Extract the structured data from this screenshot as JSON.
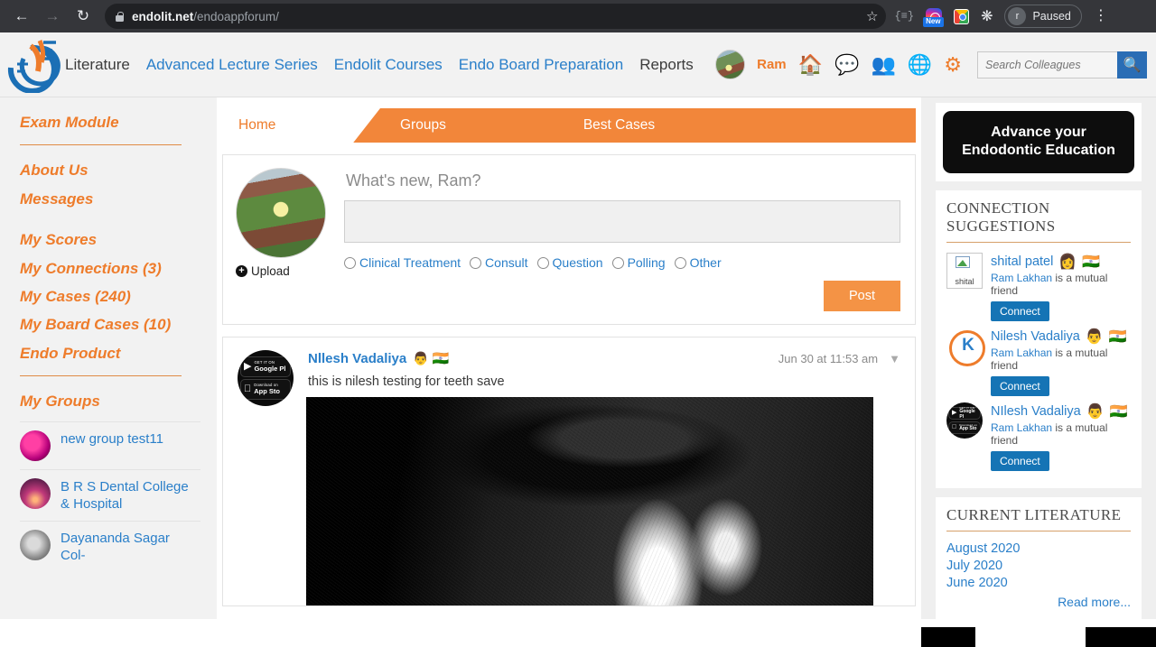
{
  "browser": {
    "back_icon": "back-arrow",
    "forward_icon": "forward-arrow",
    "reload_icon": "reload",
    "url_domain": "endolit.net",
    "url_path": "/endoappforum/",
    "bookmark_icon": "star",
    "ext_brackets_label": "{≡}",
    "new_badge": "New",
    "profile_initial": "r",
    "profile_status": "Paused",
    "menu_icon": "kebab-menu"
  },
  "header": {
    "logo_alt": "Endolit logo",
    "nav": [
      {
        "label": "Literature",
        "style": "dark"
      },
      {
        "label": "Advanced Lecture Series",
        "style": "link"
      },
      {
        "label": "Endolit Courses",
        "style": "link"
      },
      {
        "label": "Endo Board Preparation",
        "style": "link"
      },
      {
        "label": "Reports",
        "style": "dark"
      }
    ],
    "user_name": "Ram",
    "icons": [
      "home-icon",
      "chat-icon",
      "friends-icon",
      "globe-icon",
      "gear-icon"
    ],
    "search_placeholder": "Search Colleagues",
    "search_value": ""
  },
  "sidebar": {
    "links_top": [
      "Exam Module"
    ],
    "links_mid": [
      "About Us",
      "Messages"
    ],
    "links_counts": [
      "My Scores",
      "My Connections (3)",
      "My Cases (240)",
      "My Board Cases (10)",
      "Endo Product"
    ],
    "groups_title": "My Groups",
    "groups": [
      {
        "name": "new group test11"
      },
      {
        "name": "B R S Dental College & Hospital"
      },
      {
        "name": "Dayananda Sagar Col-"
      }
    ]
  },
  "tabs": [
    {
      "label": "Home",
      "active": true
    },
    {
      "label": "Groups",
      "active": false
    },
    {
      "label": "Best Cases",
      "active": false
    }
  ],
  "composer": {
    "prompt": "What's new, Ram?",
    "textarea_value": "",
    "upload_label": "Upload",
    "options": [
      "Clinical Treatment",
      "Consult",
      "Question",
      "Polling",
      "Other"
    ],
    "post_label": "Post"
  },
  "feed": [
    {
      "author": "Nllesh Vadaliya",
      "time": "Jun 30 at 11:53 am",
      "text": "this is nilesh testing for teeth save",
      "image_alt": "dental x-ray radiograph",
      "avatar_badges": [
        "GET IT ON Google Play",
        "Download on the App Store"
      ]
    }
  ],
  "right": {
    "ad_line1": "Advance your",
    "ad_line2": "Endodontic Education",
    "suggestions_title": "CONNECTION SUGGESTIONS",
    "suggestions": [
      {
        "name": "shital patel",
        "avatar_type": "broken-image",
        "avatar_alt": "shital",
        "mutual_person": "Ram Lakhan",
        "mutual_text": " is a mutual friend",
        "connect_label": "Connect"
      },
      {
        "name": "Nilesh Vadaliya",
        "avatar_type": "k-logo",
        "avatar_alt": "K",
        "mutual_person": "Ram Lakhan",
        "mutual_text": " is a mutual friend",
        "connect_label": "Connect"
      },
      {
        "name": "NIlesh Vadaliya",
        "avatar_type": "store-badges",
        "avatar_alt": "app store badges",
        "mutual_person": "Ram Lakhan",
        "mutual_text": " is a mutual friend",
        "connect_label": "Connect"
      }
    ],
    "literature_title": "CURRENT LITERATURE",
    "literature": [
      "August 2020",
      "July 2020",
      "June 2020"
    ],
    "read_more": "Read more..."
  },
  "colors": {
    "orange": "#ee7c2b",
    "orange_tab": "#f2863a",
    "blue_link": "#2a7fc9",
    "connect_blue": "#1574b5",
    "search_blue": "#2a6db5"
  }
}
